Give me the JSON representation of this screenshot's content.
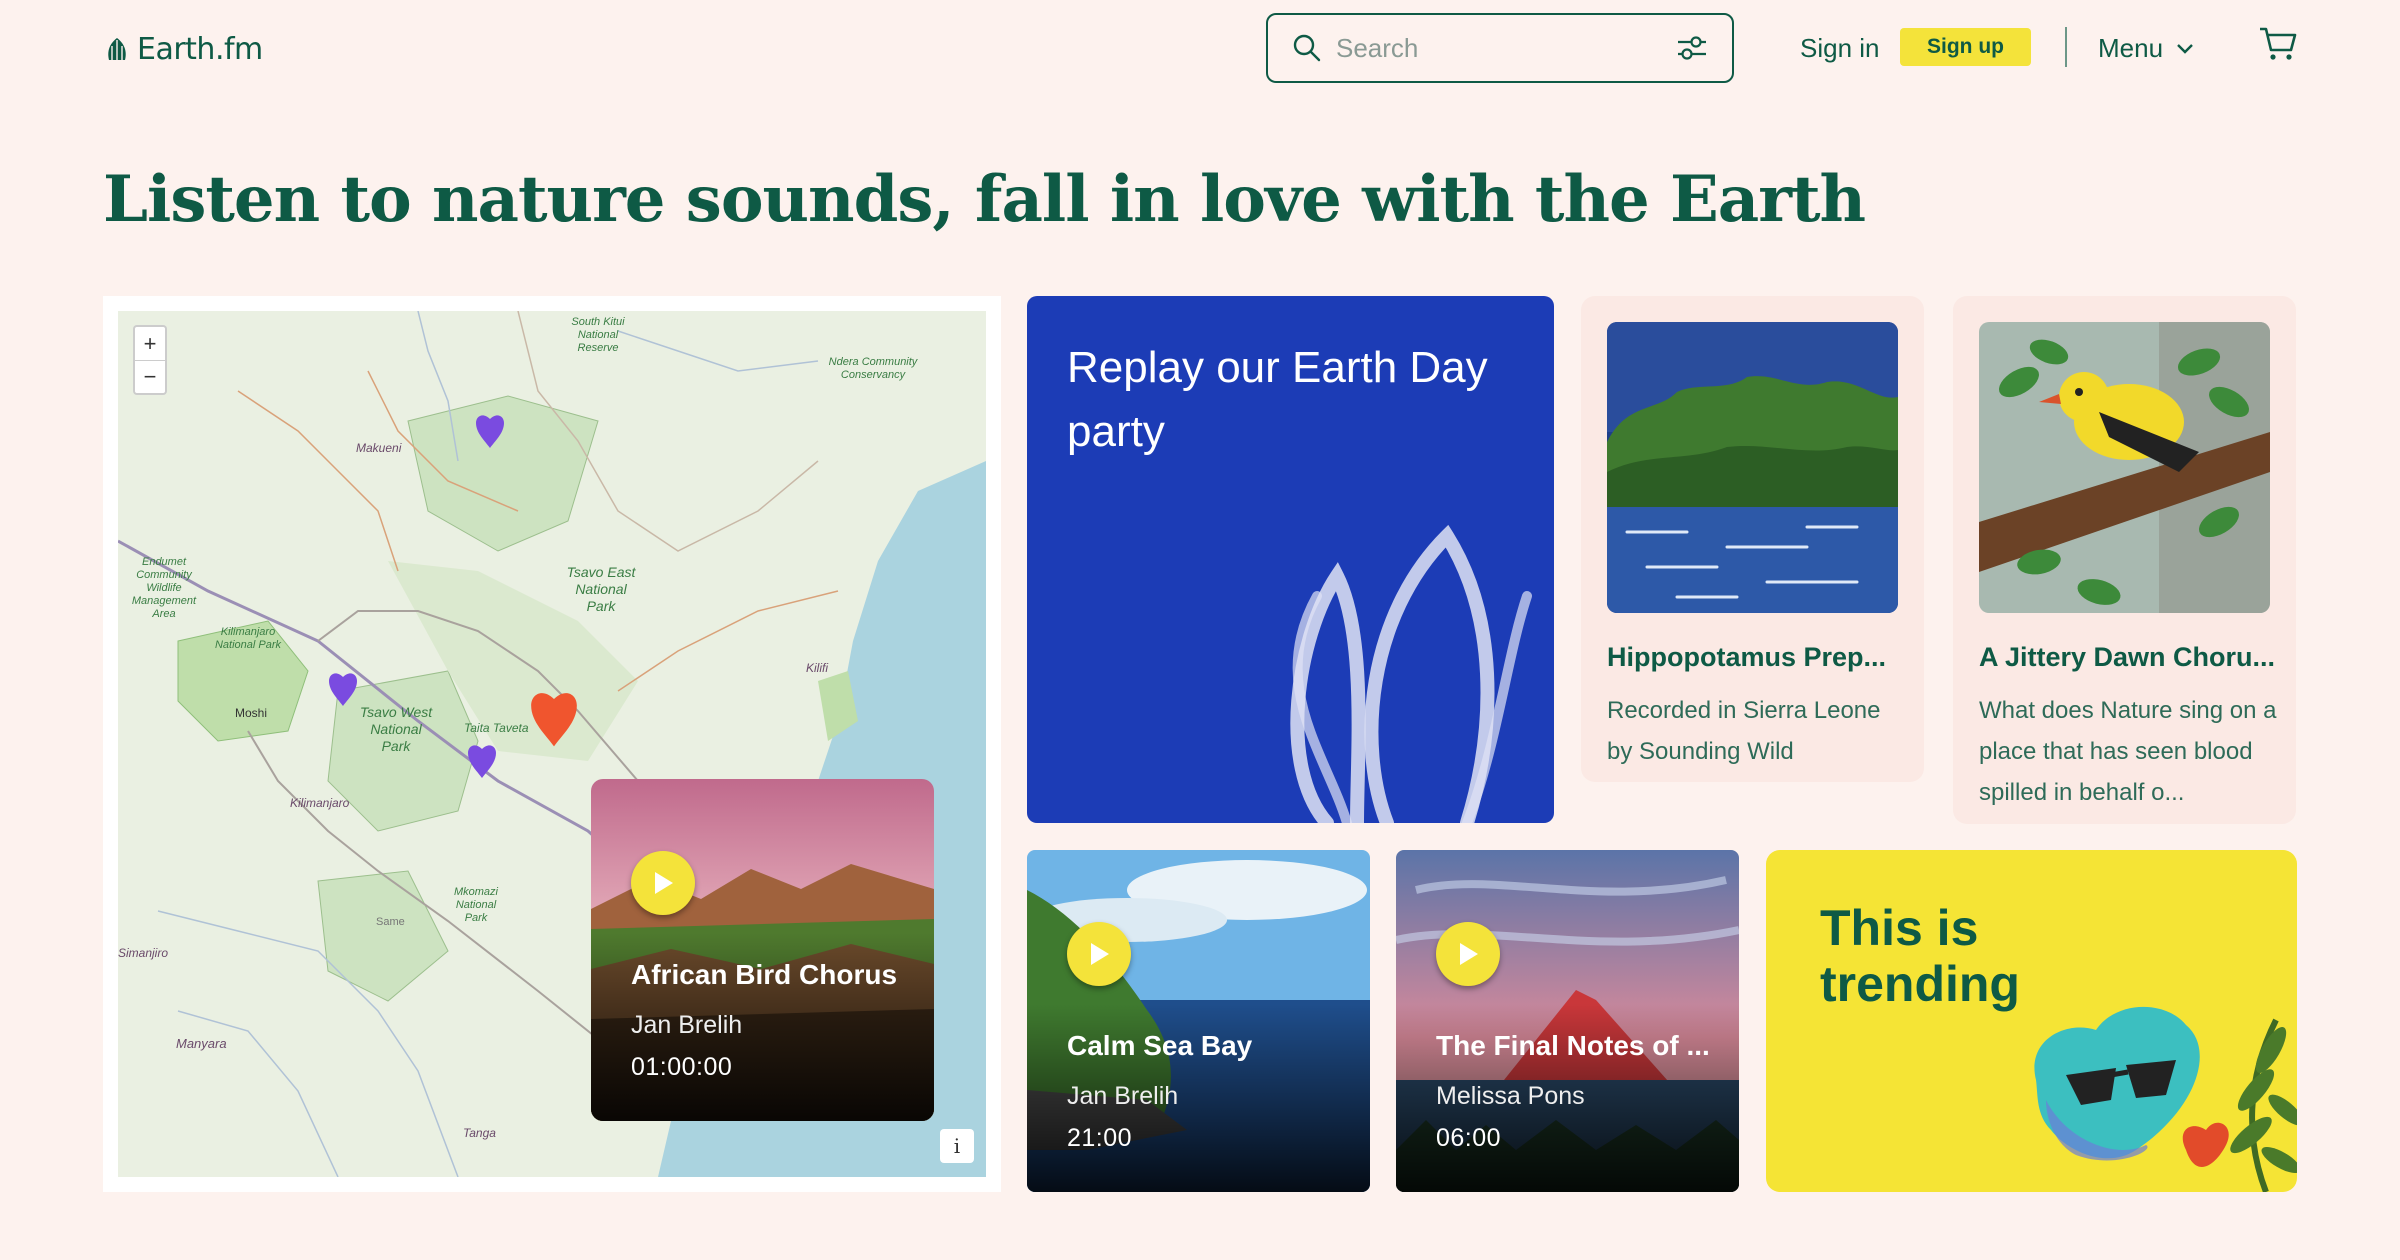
{
  "header": {
    "logo_text": "Earth.fm",
    "search_placeholder": "Search",
    "sign_in": "Sign in",
    "sign_up": "Sign up",
    "menu": "Menu"
  },
  "hero": {
    "title": "Listen to nature sounds, fall in love with the Earth"
  },
  "map": {
    "zoom_in": "+",
    "zoom_out": "−",
    "info": "i",
    "labels": [
      "South Kitui National Reserve",
      "Ndera Community Conservancy",
      "Makueni",
      "Tsavo East National Park",
      "Endumet Community Wildlife Management Area",
      "Kilimanjaro National Park",
      "Moshi",
      "Tsavo West National Park",
      "Taita Taveta",
      "Kilifi",
      "Kilimanjaro",
      "Mkomazi National Park",
      "Same",
      "Simanjiro",
      "Manyara",
      "Tanga"
    ],
    "popup": {
      "title": "African Bird Chorus",
      "author": "Jan Brelih",
      "duration": "01:00:00"
    }
  },
  "cards": {
    "earth_day": {
      "title": "Replay our Earth Day party"
    },
    "hippo": {
      "title": "Hippopotamus Prep...",
      "description": "Recorded in Sierra Leone by Sounding Wild"
    },
    "jittery": {
      "title": "A Jittery Dawn Choru...",
      "description": "What does Nature sing on a place that has seen blood spilled in behalf o..."
    },
    "calm": {
      "title": "Calm Sea Bay",
      "author": "Jan Brelih",
      "duration": "21:00"
    },
    "final": {
      "title": "The Final Notes of ...",
      "author": "Melissa Pons",
      "duration": "06:00"
    },
    "trending": {
      "title": "This is trending"
    }
  },
  "colors": {
    "brand_green": "#0e5a45",
    "accent_yellow": "#f4e33a",
    "background": "#fdf2ee",
    "earth_day_blue": "#1c3cb6",
    "marker_purple": "#7a4be0",
    "marker_active": "#f0552e"
  }
}
